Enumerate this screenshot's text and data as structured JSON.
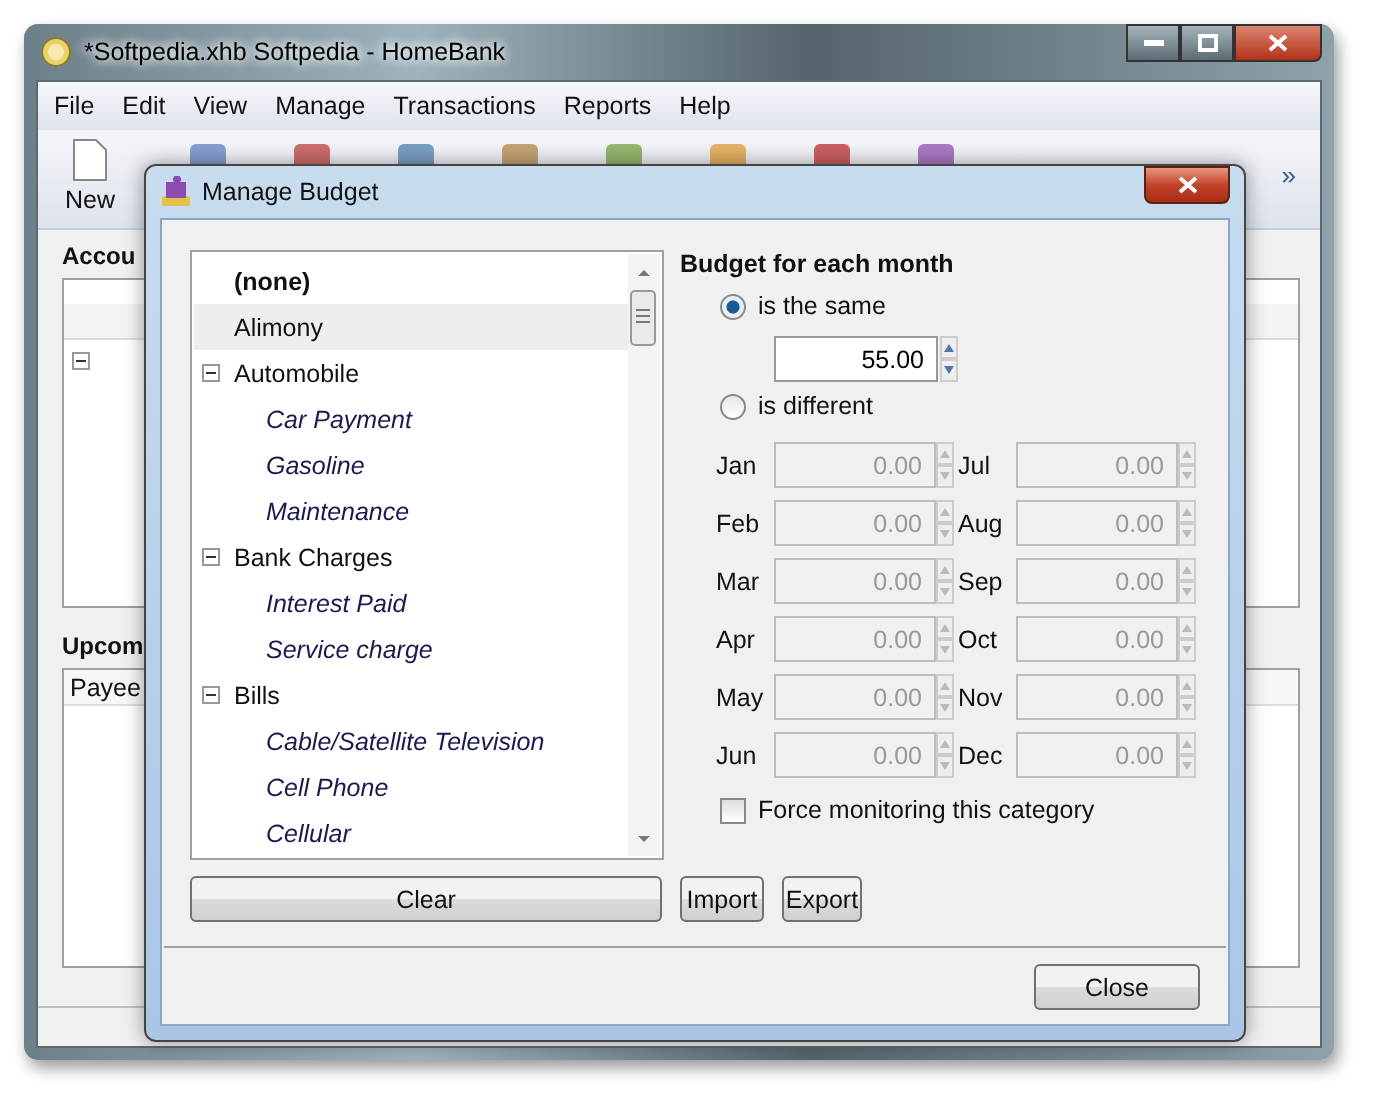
{
  "window": {
    "title": "*Softpedia.xhb Softpedia - HomeBank"
  },
  "menu": [
    "File",
    "Edit",
    "View",
    "Manage",
    "Transactions",
    "Reports",
    "Help"
  ],
  "toolbar": {
    "items": [
      {
        "label": "New"
      }
    ],
    "overflow": "»"
  },
  "accounts": {
    "title": "Accou"
  },
  "upcoming": {
    "title": "Upcom",
    "columns": [
      "Payee"
    ]
  },
  "dialog": {
    "title": "Manage Budget",
    "categories": [
      {
        "label": "(none)",
        "kind": "none",
        "selected": false
      },
      {
        "label": "Alimony",
        "kind": "category",
        "selected": true
      },
      {
        "label": "Automobile",
        "kind": "category",
        "selected": false,
        "expanded": true,
        "children": [
          {
            "label": "Car Payment",
            "kind": "subcategory",
            "selected": false
          },
          {
            "label": "Gasoline",
            "kind": "subcategory",
            "selected": false
          },
          {
            "label": "Maintenance",
            "kind": "subcategory",
            "selected": false
          }
        ]
      },
      {
        "label": "Bank Charges",
        "kind": "category",
        "selected": false,
        "expanded": true,
        "children": [
          {
            "label": "Interest Paid",
            "kind": "subcategory",
            "selected": false
          },
          {
            "label": "Service charge",
            "kind": "subcategory",
            "selected": false
          }
        ]
      },
      {
        "label": "Bills",
        "kind": "category",
        "selected": false,
        "expanded": true,
        "children": [
          {
            "label": "Cable/Satellite Television",
            "kind": "subcategory",
            "selected": false
          },
          {
            "label": "Cell Phone",
            "kind": "subcategory",
            "selected": false
          },
          {
            "label": "Cellular",
            "kind": "subcategory",
            "selected": false
          }
        ]
      }
    ],
    "budget_heading": "Budget for each month",
    "options": [
      {
        "label": "is the same",
        "selected": true
      },
      {
        "label": "is different",
        "selected": false
      }
    ],
    "same_value": "55.00",
    "months": [
      {
        "label": "Jan",
        "value": "0.00",
        "disabled": true
      },
      {
        "label": "Feb",
        "value": "0.00",
        "disabled": true
      },
      {
        "label": "Mar",
        "value": "0.00",
        "disabled": true
      },
      {
        "label": "Apr",
        "value": "0.00",
        "disabled": true
      },
      {
        "label": "May",
        "value": "0.00",
        "disabled": true
      },
      {
        "label": "Jun",
        "value": "0.00",
        "disabled": true
      },
      {
        "label": "Jul",
        "value": "0.00",
        "disabled": true
      },
      {
        "label": "Aug",
        "value": "0.00",
        "disabled": true
      },
      {
        "label": "Sep",
        "value": "0.00",
        "disabled": true
      },
      {
        "label": "Oct",
        "value": "0.00",
        "disabled": true
      },
      {
        "label": "Nov",
        "value": "0.00",
        "disabled": true
      },
      {
        "label": "Dec",
        "value": "0.00",
        "disabled": true
      }
    ],
    "force_monitoring": {
      "label": "Force monitoring this category",
      "checked": false
    },
    "list_buttons": [
      "Clear",
      "Import",
      "Export"
    ],
    "close_button": "Close"
  }
}
